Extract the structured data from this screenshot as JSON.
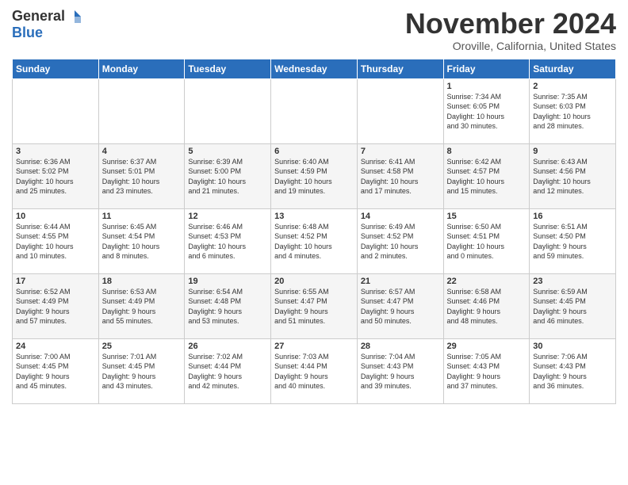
{
  "header": {
    "logo_general": "General",
    "logo_blue": "Blue",
    "month_title": "November 2024",
    "location": "Oroville, California, United States"
  },
  "weekdays": [
    "Sunday",
    "Monday",
    "Tuesday",
    "Wednesday",
    "Thursday",
    "Friday",
    "Saturday"
  ],
  "weeks": [
    [
      {
        "day": "",
        "info": ""
      },
      {
        "day": "",
        "info": ""
      },
      {
        "day": "",
        "info": ""
      },
      {
        "day": "",
        "info": ""
      },
      {
        "day": "",
        "info": ""
      },
      {
        "day": "1",
        "info": "Sunrise: 7:34 AM\nSunset: 6:05 PM\nDaylight: 10 hours\nand 30 minutes."
      },
      {
        "day": "2",
        "info": "Sunrise: 7:35 AM\nSunset: 6:03 PM\nDaylight: 10 hours\nand 28 minutes."
      }
    ],
    [
      {
        "day": "3",
        "info": "Sunrise: 6:36 AM\nSunset: 5:02 PM\nDaylight: 10 hours\nand 25 minutes."
      },
      {
        "day": "4",
        "info": "Sunrise: 6:37 AM\nSunset: 5:01 PM\nDaylight: 10 hours\nand 23 minutes."
      },
      {
        "day": "5",
        "info": "Sunrise: 6:39 AM\nSunset: 5:00 PM\nDaylight: 10 hours\nand 21 minutes."
      },
      {
        "day": "6",
        "info": "Sunrise: 6:40 AM\nSunset: 4:59 PM\nDaylight: 10 hours\nand 19 minutes."
      },
      {
        "day": "7",
        "info": "Sunrise: 6:41 AM\nSunset: 4:58 PM\nDaylight: 10 hours\nand 17 minutes."
      },
      {
        "day": "8",
        "info": "Sunrise: 6:42 AM\nSunset: 4:57 PM\nDaylight: 10 hours\nand 15 minutes."
      },
      {
        "day": "9",
        "info": "Sunrise: 6:43 AM\nSunset: 4:56 PM\nDaylight: 10 hours\nand 12 minutes."
      }
    ],
    [
      {
        "day": "10",
        "info": "Sunrise: 6:44 AM\nSunset: 4:55 PM\nDaylight: 10 hours\nand 10 minutes."
      },
      {
        "day": "11",
        "info": "Sunrise: 6:45 AM\nSunset: 4:54 PM\nDaylight: 10 hours\nand 8 minutes."
      },
      {
        "day": "12",
        "info": "Sunrise: 6:46 AM\nSunset: 4:53 PM\nDaylight: 10 hours\nand 6 minutes."
      },
      {
        "day": "13",
        "info": "Sunrise: 6:48 AM\nSunset: 4:52 PM\nDaylight: 10 hours\nand 4 minutes."
      },
      {
        "day": "14",
        "info": "Sunrise: 6:49 AM\nSunset: 4:52 PM\nDaylight: 10 hours\nand 2 minutes."
      },
      {
        "day": "15",
        "info": "Sunrise: 6:50 AM\nSunset: 4:51 PM\nDaylight: 10 hours\nand 0 minutes."
      },
      {
        "day": "16",
        "info": "Sunrise: 6:51 AM\nSunset: 4:50 PM\nDaylight: 9 hours\nand 59 minutes."
      }
    ],
    [
      {
        "day": "17",
        "info": "Sunrise: 6:52 AM\nSunset: 4:49 PM\nDaylight: 9 hours\nand 57 minutes."
      },
      {
        "day": "18",
        "info": "Sunrise: 6:53 AM\nSunset: 4:49 PM\nDaylight: 9 hours\nand 55 minutes."
      },
      {
        "day": "19",
        "info": "Sunrise: 6:54 AM\nSunset: 4:48 PM\nDaylight: 9 hours\nand 53 minutes."
      },
      {
        "day": "20",
        "info": "Sunrise: 6:55 AM\nSunset: 4:47 PM\nDaylight: 9 hours\nand 51 minutes."
      },
      {
        "day": "21",
        "info": "Sunrise: 6:57 AM\nSunset: 4:47 PM\nDaylight: 9 hours\nand 50 minutes."
      },
      {
        "day": "22",
        "info": "Sunrise: 6:58 AM\nSunset: 4:46 PM\nDaylight: 9 hours\nand 48 minutes."
      },
      {
        "day": "23",
        "info": "Sunrise: 6:59 AM\nSunset: 4:45 PM\nDaylight: 9 hours\nand 46 minutes."
      }
    ],
    [
      {
        "day": "24",
        "info": "Sunrise: 7:00 AM\nSunset: 4:45 PM\nDaylight: 9 hours\nand 45 minutes."
      },
      {
        "day": "25",
        "info": "Sunrise: 7:01 AM\nSunset: 4:45 PM\nDaylight: 9 hours\nand 43 minutes."
      },
      {
        "day": "26",
        "info": "Sunrise: 7:02 AM\nSunset: 4:44 PM\nDaylight: 9 hours\nand 42 minutes."
      },
      {
        "day": "27",
        "info": "Sunrise: 7:03 AM\nSunset: 4:44 PM\nDaylight: 9 hours\nand 40 minutes."
      },
      {
        "day": "28",
        "info": "Sunrise: 7:04 AM\nSunset: 4:43 PM\nDaylight: 9 hours\nand 39 minutes."
      },
      {
        "day": "29",
        "info": "Sunrise: 7:05 AM\nSunset: 4:43 PM\nDaylight: 9 hours\nand 37 minutes."
      },
      {
        "day": "30",
        "info": "Sunrise: 7:06 AM\nSunset: 4:43 PM\nDaylight: 9 hours\nand 36 minutes."
      }
    ]
  ]
}
